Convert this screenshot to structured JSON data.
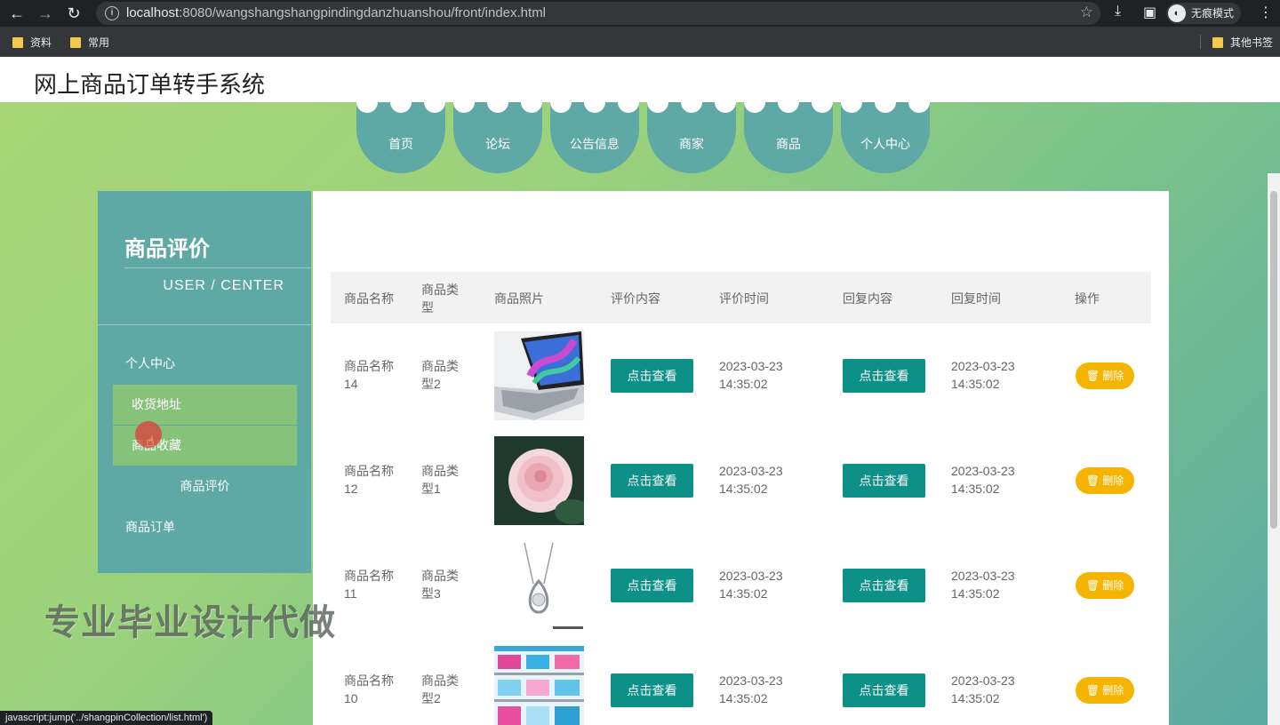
{
  "browser": {
    "url_host": "localhost",
    "url_path": ":8080/wangshangshangpindingdanzhuanshou/front/index.html",
    "incognito_label": "无痕模式",
    "bookmarks": [
      "资料",
      "常用"
    ],
    "other_bookmarks": "其他书签",
    "status_text": "javascript:jump('../shangpinCollection/list.html')"
  },
  "site": {
    "title": "网上商品订单转手系统"
  },
  "nav": {
    "items": [
      "首页",
      "论坛",
      "公告信息",
      "商家",
      "商品",
      "个人中心"
    ]
  },
  "sidebar": {
    "title": "商品评价",
    "subtitle": "USER / CENTER",
    "items": [
      "个人中心",
      "收货地址",
      "商品收藏",
      "商品评价",
      "商品订单"
    ]
  },
  "watermark": "专业毕业设计代做",
  "table": {
    "headers": [
      "商品名称",
      "商品类型",
      "商品照片",
      "评价内容",
      "评价时间",
      "回复内容",
      "回复时间",
      "操作"
    ],
    "view_label": "点击查看",
    "delete_label": "删除",
    "rows": [
      {
        "name": "商品名称14",
        "type": "商品类型2",
        "photo": "laptop",
        "time": "2023-03-23 14:35:02",
        "reply_time": "2023-03-23 14:35:02"
      },
      {
        "name": "商品名称12",
        "type": "商品类型1",
        "photo": "rose",
        "time": "2023-03-23 14:35:02",
        "reply_time": "2023-03-23 14:35:02"
      },
      {
        "name": "商品名称11",
        "type": "商品类型3",
        "photo": "necklace",
        "time": "2023-03-23 14:35:02",
        "reply_time": "2023-03-23 14:35:02"
      },
      {
        "name": "商品名称10",
        "type": "商品类型2",
        "photo": "shelf",
        "time": "2023-03-23 14:35:02",
        "reply_time": "2023-03-23 14:35:02"
      }
    ]
  },
  "colors": {
    "teal": "#5ea8a6",
    "green": "#a8d676",
    "button": "#0c9088",
    "delete": "#f5b400"
  }
}
